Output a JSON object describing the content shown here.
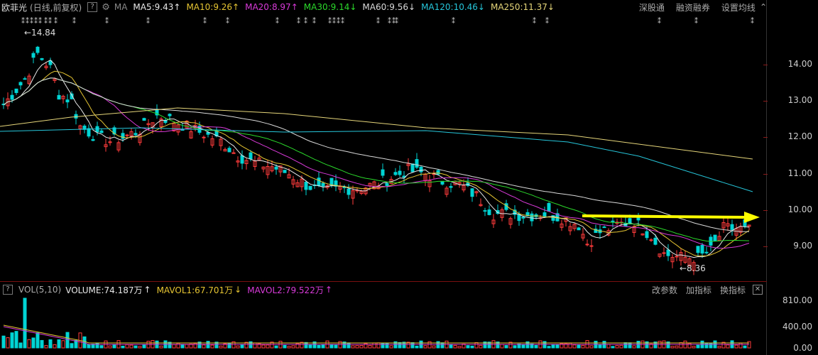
{
  "header": {
    "stock_name": "欧菲光",
    "period": "(日线,前复权)",
    "help_glyph": "?",
    "ma_label": "MA",
    "ma_items": [
      {
        "label": "MA5:9.43",
        "arrow": "↑",
        "color": "#e8e8e8"
      },
      {
        "label": "MA10:9.26",
        "arrow": "↑",
        "color": "#e6c532"
      },
      {
        "label": "MA20:8.97",
        "arrow": "↑",
        "color": "#d93ad9"
      },
      {
        "label": "MA30:9.14",
        "arrow": "↓",
        "color": "#2bd92b"
      },
      {
        "label": "MA60:9.56",
        "arrow": "↓",
        "color": "#d9d9d9"
      },
      {
        "label": "MA120:10.46",
        "arrow": "↓",
        "color": "#26c6da"
      },
      {
        "label": "MA250:11.37",
        "arrow": "↓",
        "color": "#e6d67a"
      }
    ],
    "right_links": [
      "深股通",
      "融资融券",
      "设置均线"
    ]
  },
  "price_axis": [
    "14.00",
    "13.00",
    "12.00",
    "11.00",
    "10.00",
    "9.00"
  ],
  "annotations": {
    "high": "←14.84",
    "low": "←8.36"
  },
  "volume_header": {
    "question": "?",
    "vol_label": "VOL(5,10)",
    "volume": "VOLUME:74.187万",
    "volume_arrow": "↑",
    "mavol1": "MAVOL1:67.701万",
    "mavol1_arrow": "↓",
    "mavol2": "MAVOL2:79.522万",
    "mavol2_arrow": "↑",
    "buttons": [
      "改参数",
      "加指标",
      "换指标"
    ],
    "close": "✕"
  },
  "volume_axis": [
    "810.00",
    "400.00",
    "0.00"
  ],
  "colors": {
    "up": "#ff3b3b",
    "down": "#00d4d4",
    "arrow": "#ffff00"
  },
  "chart_data": {
    "type": "candlestick",
    "price_ylim": [
      8.36,
      14.84
    ],
    "high_label": 14.84,
    "low_label": 8.36,
    "ma_latest": {
      "MA5": 9.43,
      "MA10": 9.26,
      "MA20": 8.97,
      "MA30": 9.14,
      "MA60": 9.56,
      "MA120": 10.46,
      "MA250": 11.37
    },
    "volume_latest_wan": 74.187,
    "mavol1_wan": 67.701,
    "mavol2_wan": 79.522
  }
}
